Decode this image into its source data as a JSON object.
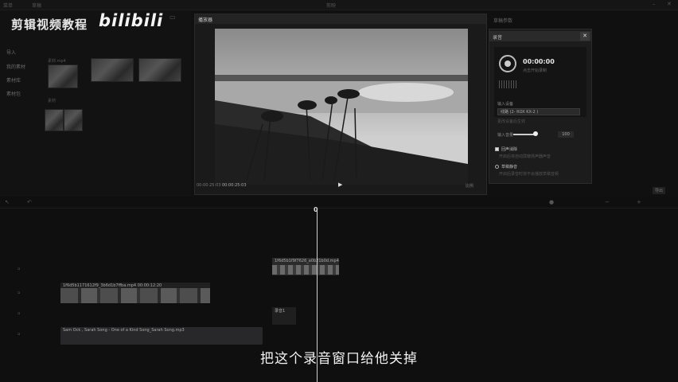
{
  "watermark": {
    "title": "剪辑视频教程",
    "logo": "bilibili"
  },
  "app": {
    "window_title": "剪映",
    "menu": [
      "菜单",
      "草稿"
    ]
  },
  "left_panel": {
    "side_items": [
      "导入",
      "我的素材",
      "素材库",
      "素材包"
    ],
    "clip_labels": [
      "bilibili",
      "素材.mp4",
      "xxx.mp4",
      "素材"
    ]
  },
  "player": {
    "title": "播放器",
    "time_current": "00:00:25:03",
    "time_total": "00:00:25:03",
    "ratio_label": "比例"
  },
  "recording": {
    "header": "草稿参数",
    "panel_title": "录音",
    "timer": "00:00:00",
    "status": "点击开始录制",
    "input_device_label": "输入设备",
    "input_device_value": "线路 (2- ROX KX-2 )",
    "device_hint": "更改设备后生效",
    "input_volume_label": "输入音量",
    "input_volume_value": "100",
    "input_volume_level": 1.0,
    "echo_label": "回声消除",
    "echo_desc": "开启后将自动屏蔽扬声器声音",
    "mute_label": "草稿静音",
    "mute_desc": "开启后录音时将不会播放草稿音频"
  },
  "timeline": {
    "playhead_label": "0",
    "video_clip": "1f6d5b1171612f9_3b6d1b7ffba.mp4   00:00:12:20",
    "audio_top_clip": "1f6d5b1f9f7626_a0b21b0d.mp4",
    "record_clip": "录音1",
    "music_clip": "Sam Ock , Sarah Song - One of a Kind Song_Sarah Song.mp3",
    "export_label": "导出"
  },
  "subtitle": "把这个录音窗口给他关掉"
}
